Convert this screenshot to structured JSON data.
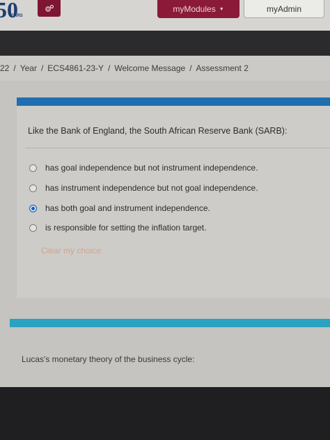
{
  "header": {
    "logo_number": "50",
    "logo_sub": "YEARS",
    "settings_icon": "gears-icon",
    "modules_label": "myModules",
    "admin_label": "myAdmin"
  },
  "breadcrumb": [
    "22",
    "Year",
    "ECS4861-23-Y",
    "Welcome Message",
    "Assessment 2"
  ],
  "question1": {
    "text": "Like the Bank of England, the South African Reserve Bank (SARB):",
    "options": [
      {
        "label": "has goal independence but not instrument independence.",
        "selected": false
      },
      {
        "label": "has instrument independence but not goal independence.",
        "selected": false
      },
      {
        "label": "has both goal and instrument independence.",
        "selected": true
      },
      {
        "label": "is responsible for setting the inflation target.",
        "selected": false
      }
    ],
    "clear_label": "Clear my choice"
  },
  "question2": {
    "text": "Lucas's monetary theory of the business cycle:"
  },
  "colors": {
    "brand": "#8a1a37",
    "card_bar": "#1f6fb0",
    "card2_bar": "#2aa2c0",
    "radio_selected": "#1760b8",
    "clear_link": "#d4a38e"
  }
}
